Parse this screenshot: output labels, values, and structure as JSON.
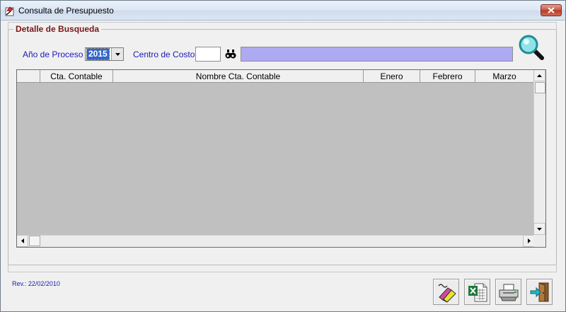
{
  "window": {
    "title": "Consulta de Presupuesto",
    "icons": {
      "app": "budget-form-icon",
      "close": "close-icon"
    }
  },
  "search_group": {
    "legend": "Detalle de Busqueda",
    "year_label": "Año de Proceso :",
    "year_value": "2015",
    "cost_center_label": "Centro de Costo:",
    "cost_center_code": "",
    "cost_center_description": "",
    "icons": {
      "lookup": "binoculars-icon",
      "search": "magnifier-icon"
    }
  },
  "grid": {
    "columns": [
      "",
      "Cta. Contable",
      "Nombre Cta. Contable",
      "Enero",
      "Febrero",
      "Marzo"
    ],
    "rows": []
  },
  "footer": {
    "revision": "Rev.: 22/02/2010",
    "buttons": [
      {
        "name": "clear-button",
        "icon": "eraser-icon"
      },
      {
        "name": "export-excel-button",
        "icon": "excel-icon"
      },
      {
        "name": "print-button",
        "icon": "printer-icon"
      },
      {
        "name": "exit-button",
        "icon": "exit-door-icon"
      }
    ]
  },
  "colors": {
    "legend_text": "#7a1717",
    "label_text": "#1a1ab8",
    "description_field": "#aeaaf2",
    "grid_background": "#c0c0c0",
    "selection": "#3366cc"
  }
}
